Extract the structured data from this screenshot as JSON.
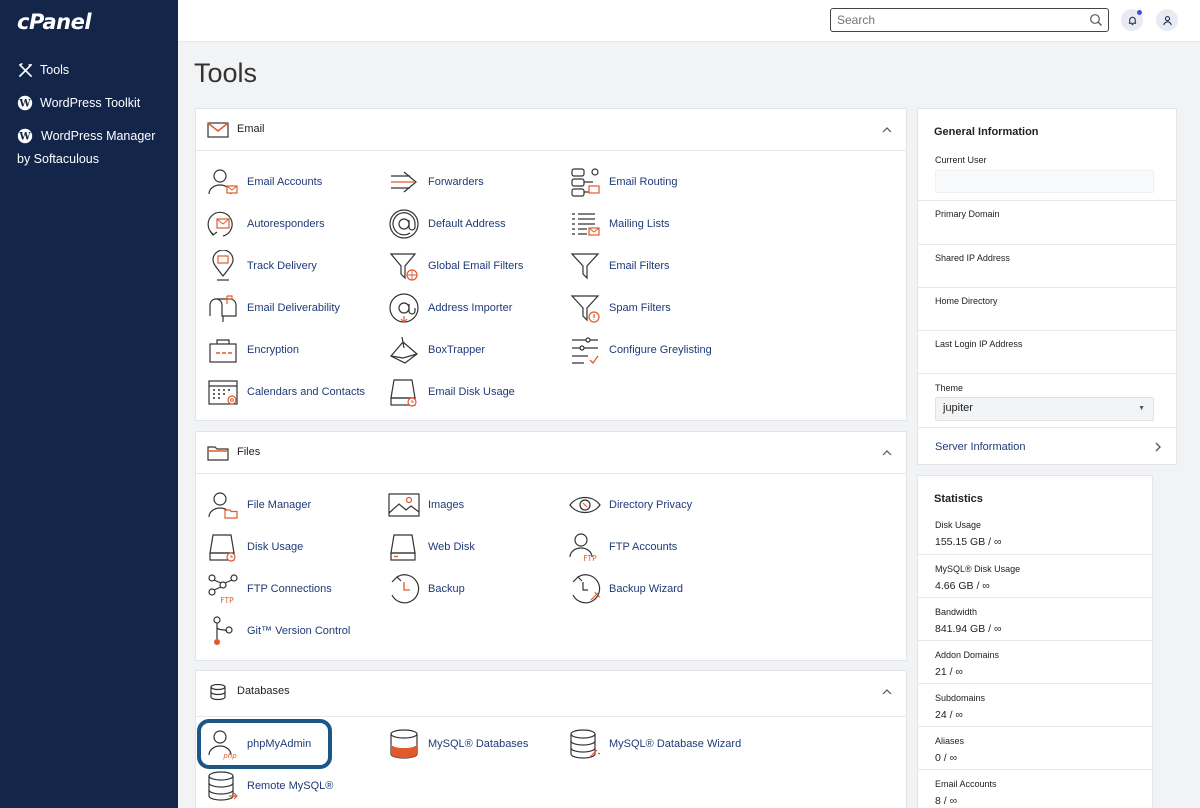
{
  "sidebar": {
    "logo": "cPanel",
    "items": [
      {
        "label": "Tools",
        "icon": "tools-icon"
      },
      {
        "label": "WordPress Toolkit",
        "icon": "wordpress-icon"
      },
      {
        "label": "WordPress Manager by Softaculous",
        "icon": "wordpress-icon"
      }
    ]
  },
  "header": {
    "search_placeholder": "Search"
  },
  "page_title": "Tools",
  "sections": [
    {
      "title": "Email",
      "tools": [
        {
          "label": "Email Accounts",
          "icon": "email-accounts-icon"
        },
        {
          "label": "Forwarders",
          "icon": "forwarders-icon"
        },
        {
          "label": "Email Routing",
          "icon": "email-routing-icon"
        },
        {
          "label": "Autoresponders",
          "icon": "autoresponders-icon"
        },
        {
          "label": "Default Address",
          "icon": "at-sign-icon"
        },
        {
          "label": "Mailing Lists",
          "icon": "mailing-lists-icon"
        },
        {
          "label": "Track Delivery",
          "icon": "track-delivery-icon"
        },
        {
          "label": "Global Email Filters",
          "icon": "global-filter-icon"
        },
        {
          "label": "Email Filters",
          "icon": "filter-icon"
        },
        {
          "label": "Email Deliverability",
          "icon": "mailbox-icon"
        },
        {
          "label": "Address Importer",
          "icon": "address-importer-icon"
        },
        {
          "label": "Spam Filters",
          "icon": "spam-filter-icon"
        },
        {
          "label": "Encryption",
          "icon": "encryption-icon"
        },
        {
          "label": "BoxTrapper",
          "icon": "boxtrapper-icon"
        },
        {
          "label": "Configure Greylisting",
          "icon": "greylisting-icon"
        },
        {
          "label": "Calendars and Contacts",
          "icon": "calendar-icon"
        },
        {
          "label": "Email Disk Usage",
          "icon": "email-disk-usage-icon"
        }
      ]
    },
    {
      "title": "Files",
      "tools": [
        {
          "label": "File Manager",
          "icon": "file-manager-icon"
        },
        {
          "label": "Images",
          "icon": "images-icon"
        },
        {
          "label": "Directory Privacy",
          "icon": "eye-icon"
        },
        {
          "label": "Disk Usage",
          "icon": "disk-usage-icon"
        },
        {
          "label": "Web Disk",
          "icon": "web-disk-icon"
        },
        {
          "label": "FTP Accounts",
          "icon": "ftp-accounts-icon"
        },
        {
          "label": "FTP Connections",
          "icon": "ftp-connections-icon"
        },
        {
          "label": "Backup",
          "icon": "backup-icon"
        },
        {
          "label": "Backup Wizard",
          "icon": "backup-wizard-icon"
        },
        {
          "label": "Git™ Version Control",
          "icon": "git-icon"
        }
      ]
    },
    {
      "title": "Databases",
      "tools": [
        {
          "label": "phpMyAdmin",
          "icon": "phpmyadmin-icon"
        },
        {
          "label": "MySQL® Databases",
          "icon": "mysql-databases-icon"
        },
        {
          "label": "MySQL® Database Wizard",
          "icon": "mysql-wizard-icon"
        },
        {
          "label": "Remote MySQL®",
          "icon": "remote-mysql-icon"
        }
      ]
    }
  ],
  "general_info": {
    "title": "General Information",
    "current_user_label": "Current User",
    "primary_domain_label": "Primary Domain",
    "shared_ip_label": "Shared IP Address",
    "home_dir_label": "Home Directory",
    "last_login_label": "Last Login IP Address",
    "theme_label": "Theme",
    "theme_value": "jupiter",
    "server_info_link": "Server Information"
  },
  "statistics": {
    "title": "Statistics",
    "items": [
      {
        "label": "Disk Usage",
        "value": "155.15 GB / ∞"
      },
      {
        "label": "MySQL® Disk Usage",
        "value": "4.66 GB / ∞"
      },
      {
        "label": "Bandwidth",
        "value": "841.94 GB / ∞"
      },
      {
        "label": "Addon Domains",
        "value": "21 / ∞"
      },
      {
        "label": "Subdomains",
        "value": "24 / ∞"
      },
      {
        "label": "Aliases",
        "value": "0 / ∞"
      },
      {
        "label": "Email Accounts",
        "value": "8 / ∞"
      }
    ]
  },
  "colors": {
    "sidebar_bg": "#14254a",
    "link": "#1f3a78",
    "accent_orange": "#e05a2b",
    "highlight_ring": "#1b5689"
  }
}
